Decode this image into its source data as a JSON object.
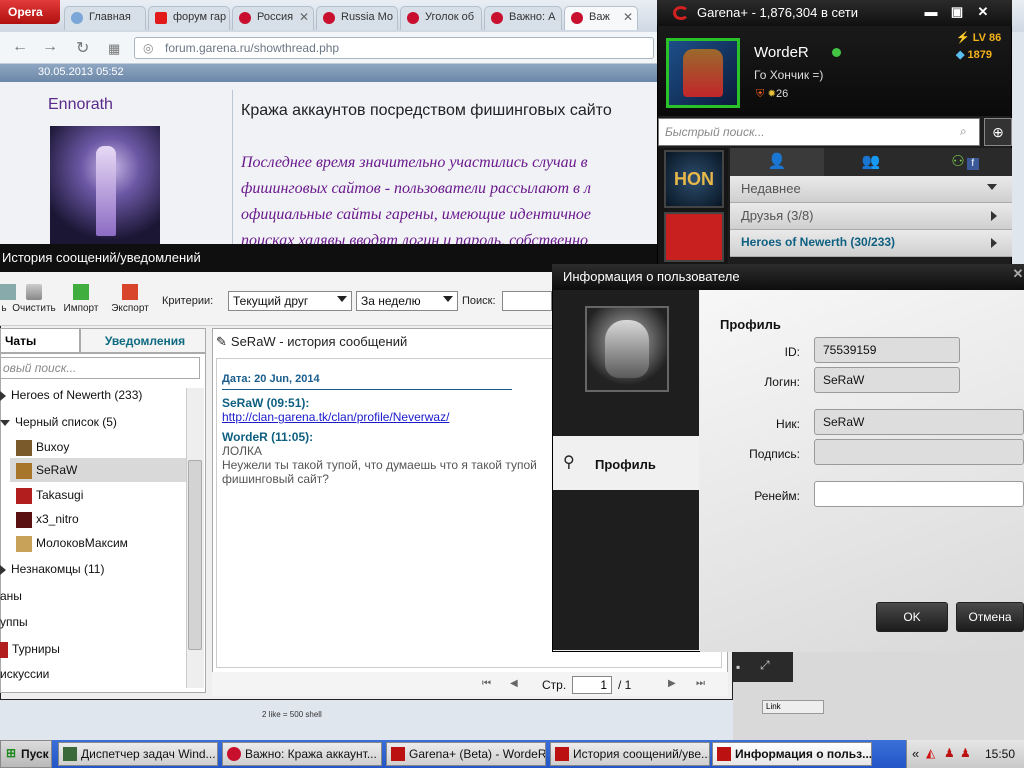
{
  "browser": {
    "app_name": "Opera",
    "tabs": [
      "Главная",
      "форум гар",
      "Россия",
      "Russia Mo",
      "Уголок об",
      "Важно: А",
      "Важ"
    ],
    "address": "forum.garena.ru/showthread.php"
  },
  "forum": {
    "post_date": "30.05.2013 05:52",
    "poster": "Ennorath",
    "thread_title": "Кража аккаунтов посредством фишинговых сайто",
    "body_lines": [
      "Последнее время значительно участились случаи в",
      "фишинговых сайтов - пользователи рассылают в л",
      "официальные сайты гарены, имеющие идентичное",
      "поисках халявы вводят логин и пароль, собственно"
    ]
  },
  "history": {
    "title": "История соoщений/уведомлений",
    "toolbar": {
      "clear": "Очистить",
      "import": "Импорт",
      "export": "Экспорт",
      "criteria_label": "Критерии:",
      "friend_select": "Текущий друг",
      "period_select": "За неделю",
      "search_label": "Поиск:",
      "left_cut": "ь"
    },
    "tabs": {
      "chats": "Чаты",
      "notifications": "Уведомления"
    },
    "search_placeholder": "овый поиск...",
    "tree": {
      "hon": "Heroes of Newerth (233)",
      "blacklist": "Черный список (5)",
      "users": [
        "Buxoy",
        "SeRaW",
        "Takasugi",
        "x3_nitro",
        "МолоковМаксим"
      ],
      "strangers": "Незнакомцы (11)",
      "clans": "аны",
      "groups": "уппы",
      "tournaments": "Турниры",
      "discussions": "искуссии"
    },
    "conversation": {
      "title": "SeRaW - история сообщений",
      "date": "Дата: 20 Jun, 2014",
      "msg1_author": "SeRaW  (09:51):",
      "msg1_link": "http://clan-garena.tk/clan/profile/Neverwaz/",
      "msg2_author": "WordeR  (11:05):",
      "msg2_lines": [
        "ЛОЛКА",
        "Неужели ты такой тупой, что думаешь что я такой тупой",
        "фишинговый сайт?"
      ]
    },
    "pager": {
      "label": "Стр.",
      "page": "1",
      "total": "/ 1"
    }
  },
  "garena": {
    "title": "Garena+ - 1,876,304 в сети",
    "username": "WordeR",
    "status": "Го Хончик =)",
    "level": "LV 86",
    "shells": "1879",
    "badge_count": "26",
    "search_placeholder": "Быстрый поиск...",
    "hon_tile": "HON",
    "sections": [
      "Недавнее",
      "Друзья (3/8)",
      "Heroes of Newerth (30/233)"
    ]
  },
  "userinfo": {
    "title": "Информация о пользователе",
    "nav_profile": "Профиль",
    "section": "Профиль",
    "labels": {
      "id": "ID:",
      "login": "Логин:",
      "nick": "Ник:",
      "signature": "Подпись:",
      "rename": "Ренейм:"
    },
    "values": {
      "id": "75539159",
      "login": "SeRaW",
      "nick": "SeRaW",
      "signature": "",
      "rename": ""
    },
    "ok": "OK",
    "cancel": "Отмена"
  },
  "background_window": {
    "line1": "2 like = 500 shell",
    "link": "Link"
  },
  "taskbar": {
    "start": "Пуск",
    "items": [
      "Диспетчер задач Wind...",
      "Важно: Кража аккаунт...",
      "Garena+ (Beta) - WordeR",
      "История соoщений/уве...",
      "Информация о польз..."
    ],
    "clock": "15:50",
    "tray_arrows": "«"
  },
  "colors": {
    "garena_red": "#d32020",
    "online_green": "#43c443",
    "level_gold": "#f3b21c",
    "forum_purple": "#6a1a8c"
  }
}
